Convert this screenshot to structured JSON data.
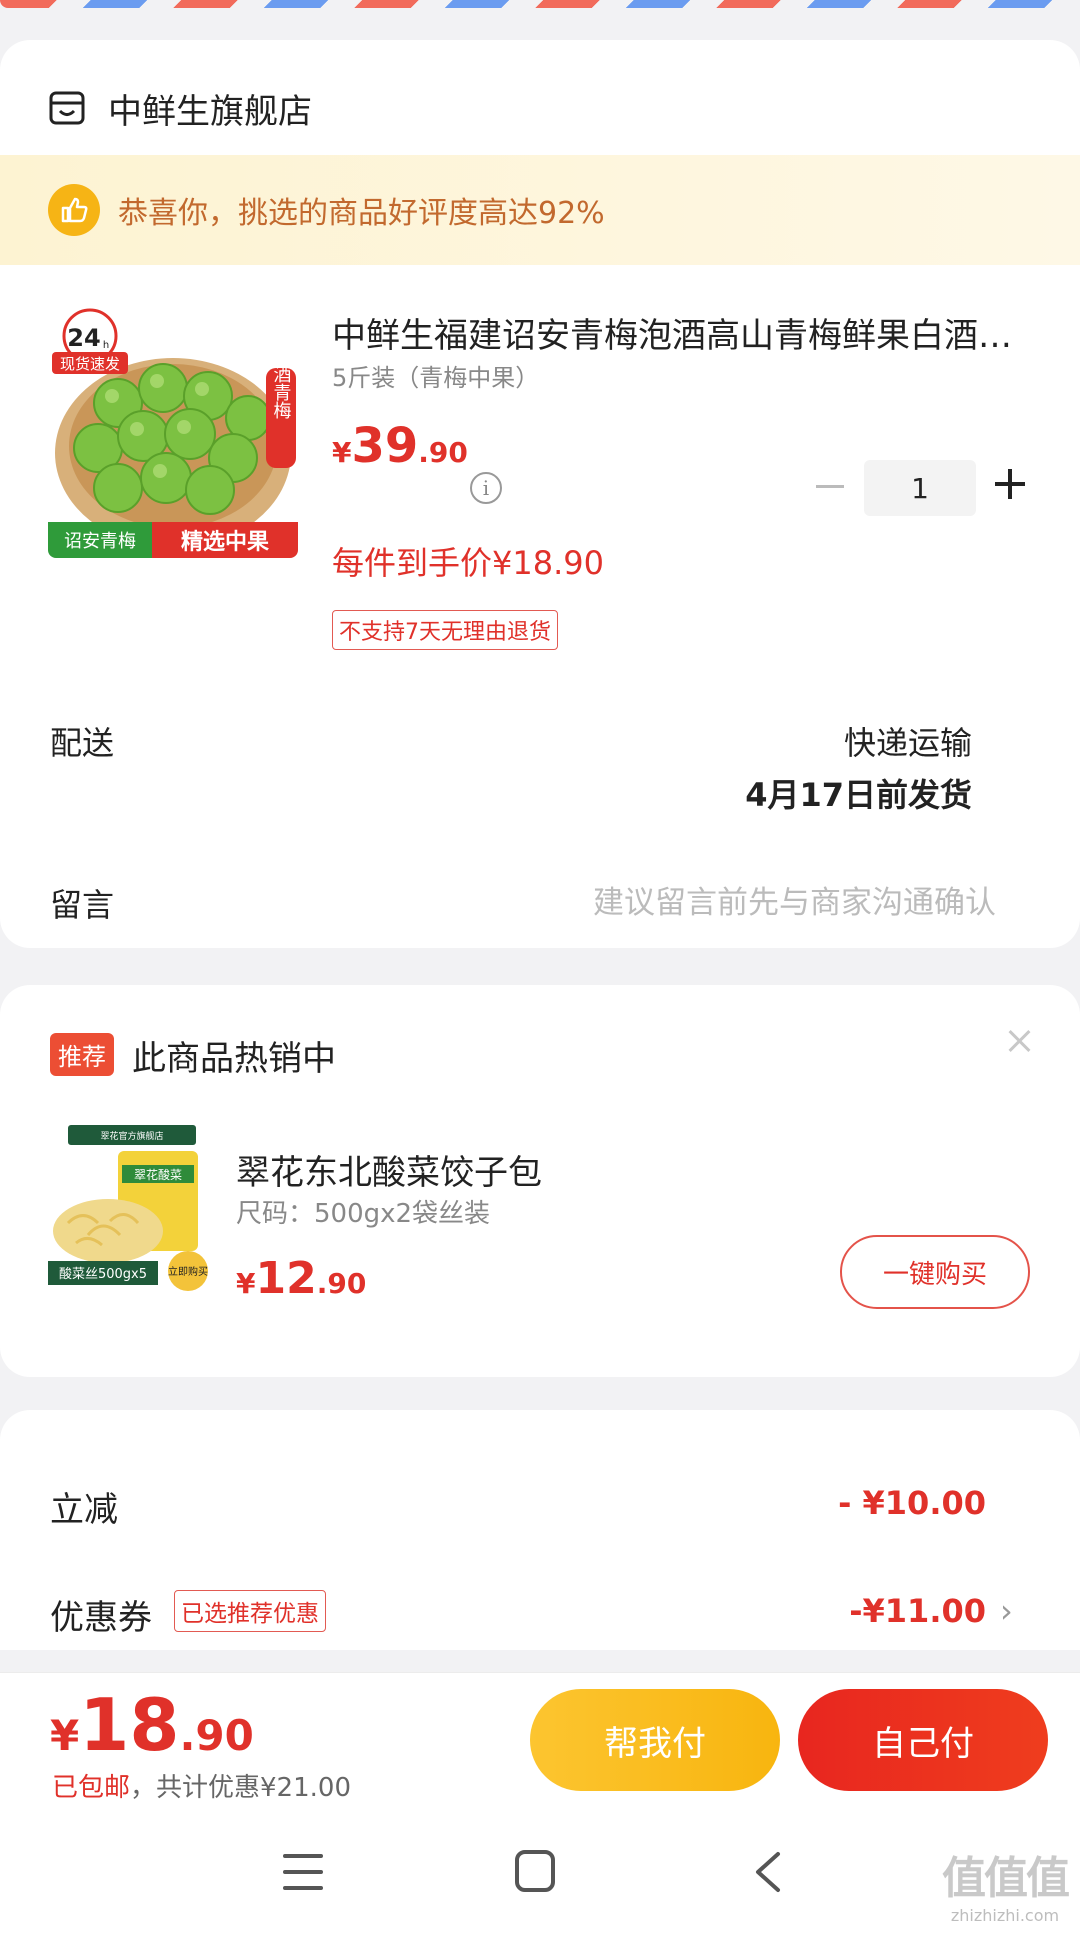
{
  "colors": {
    "accent_red": "#e0312a",
    "button_yellow": "#f8b50f",
    "banner_bg": "#fdf3d2"
  },
  "store": {
    "icon": "store-icon",
    "name": "中鲜生旗舰店"
  },
  "banner": {
    "icon": "thumbs-up-icon",
    "text": "恭喜你，挑选的商品好评度高达92%"
  },
  "product": {
    "image_labels": {
      "badge_hours": "24",
      "badge_hours_unit": "h",
      "badge_ship": "现货速发",
      "side": "泡酒青梅",
      "bottom_left": "诏安青梅",
      "bottom_right": "精选中果"
    },
    "title": "中鲜生福建诏安青梅泡酒高山青梅鲜果白酒酿酒用",
    "spec": "5斤装（青梅中果）",
    "price_symbol": "¥",
    "price_int": "39",
    "price_dec": ".90",
    "info_icon": "i",
    "quantity": "1",
    "unit_price": "每件到手价¥18.90",
    "return_policy": "不支持7天无理由退货"
  },
  "delivery": {
    "label": "配送",
    "method": "快递运输",
    "date": "4月17日前发货"
  },
  "message": {
    "label": "留言",
    "placeholder": "建议留言前先与商家沟通确认"
  },
  "recommend": {
    "tag": "推荐",
    "title": "此商品热销中",
    "image_labels": {
      "store": "翠花官方旗舰店",
      "pack": "翠花酸菜",
      "bottom": "酸菜丝500gx5",
      "cta": "立即购买"
    },
    "name": "翠花东北酸菜饺子包",
    "spec": "尺码：500gx2袋丝装",
    "price_symbol": "¥",
    "price_int": "12",
    "price_dec": ".90",
    "buy_label": "一键购买"
  },
  "discounts": [
    {
      "label": "立减",
      "value": "- ¥10.00"
    },
    {
      "label": "优惠券",
      "tag": "已选推荐优惠",
      "value": "-¥11.00"
    }
  ],
  "footer": {
    "price_symbol": "¥",
    "price_int": "18",
    "price_dec": ".90",
    "shipping": "已包邮",
    "savings": "，共计优惠¥21.00",
    "help_pay_label": "帮我付",
    "self_pay_label": "自己付"
  },
  "nav": {
    "items": [
      "menu-icon",
      "home-icon",
      "back-icon"
    ]
  },
  "watermark": {
    "big": "值值值",
    "small": "zhizhizhi.com"
  }
}
